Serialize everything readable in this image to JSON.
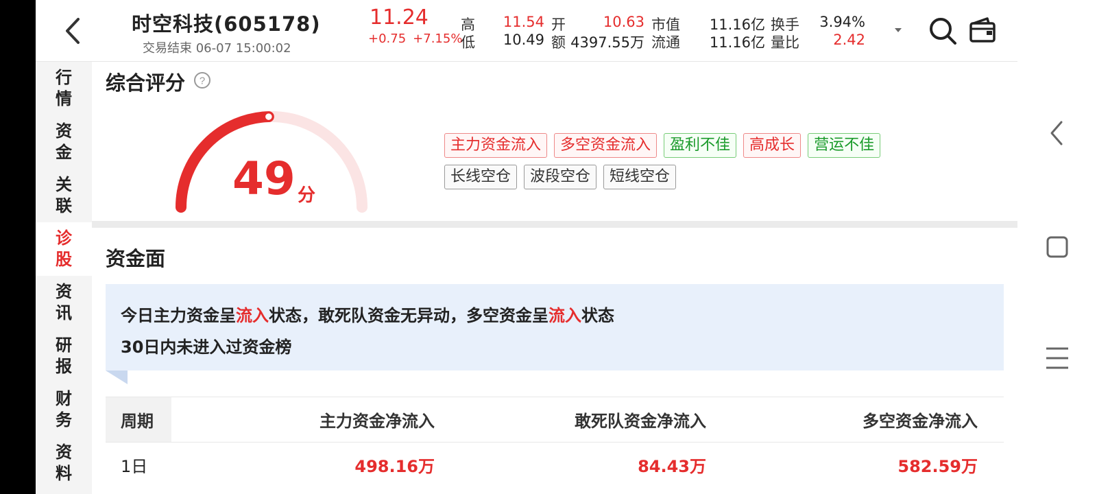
{
  "header": {
    "stock_title": "时空科技(605178)",
    "status": "交易结束 06-07 15:00:02",
    "price": "11.24",
    "change": "+0.75",
    "change_pct": "+7.15%",
    "quotes": {
      "high_label": "高",
      "high": "11.54",
      "low_label": "低",
      "low": "10.49",
      "open_label": "开",
      "open": "10.63",
      "amount_label": "额",
      "amount": "4397.55万",
      "mktcap_label": "市值",
      "mktcap": "11.16亿",
      "float_label": "流通",
      "float": "11.16亿",
      "turnover_label": "换手",
      "turnover": "3.94%",
      "volratio_label": "量比",
      "volratio": "2.42"
    }
  },
  "sidenav": {
    "items": [
      {
        "label": "行情",
        "active": false
      },
      {
        "label": "资金",
        "active": false
      },
      {
        "label": "关联",
        "active": false
      },
      {
        "label": "诊股",
        "active": true
      },
      {
        "label": "资讯",
        "active": false
      },
      {
        "label": "研报",
        "active": false
      },
      {
        "label": "财务",
        "active": false
      },
      {
        "label": "资料",
        "active": false
      }
    ]
  },
  "score": {
    "title": "综合评分",
    "value": "49",
    "unit": "分",
    "max": 100,
    "tags_row1": [
      {
        "label": "主力资金流入",
        "tone": "red"
      },
      {
        "label": "多空资金流入",
        "tone": "red"
      },
      {
        "label": "盈利不佳",
        "tone": "green"
      },
      {
        "label": "高成长",
        "tone": "red"
      },
      {
        "label": "营运不佳",
        "tone": "green"
      }
    ],
    "tags_row2": [
      {
        "label": "长线空仓",
        "tone": "gray"
      },
      {
        "label": "波段空仓",
        "tone": "gray"
      },
      {
        "label": "短线空仓",
        "tone": "gray"
      }
    ]
  },
  "capital": {
    "title": "资金面",
    "summary": {
      "p1": "今日主力资金呈",
      "h1": "流入",
      "p2": "状态，敢死队资金无异动，多空资金呈",
      "h2": "流入",
      "p3": "状态",
      "line2": "30日内未进入过资金榜"
    },
    "table": {
      "headers": [
        "周期",
        "主力资金净流入",
        "敢死队资金净流入",
        "多空资金净流入"
      ],
      "rows": [
        {
          "period": "1日",
          "main": "498.16万",
          "dare": "84.43万",
          "longshort": "582.59万"
        }
      ]
    }
  },
  "colors": {
    "accent_red": "#e52d2d",
    "accent_green": "#1a9a2a",
    "summary_bg": "#e8f0fb"
  }
}
